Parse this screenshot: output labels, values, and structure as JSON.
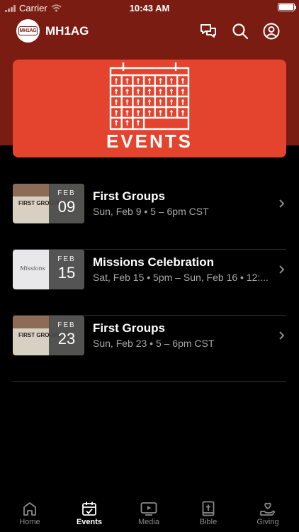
{
  "status_bar": {
    "carrier": "Carrier",
    "time": "10:43 AM"
  },
  "header": {
    "logo_text": "MH1AG",
    "title": "MH1AG"
  },
  "banner": {
    "text": "EVENTS",
    "color": "#e4442e"
  },
  "events": [
    {
      "thumb_text": "FIRST GROUPS",
      "month": "FEB",
      "day": "09",
      "title": "First Groups",
      "subtitle": "Sun, Feb 9 • 5 – 6pm CST"
    },
    {
      "thumb_text": "Missions",
      "month": "FEB",
      "day": "15",
      "title": "Missions Celebration",
      "subtitle": "Sat, Feb 15 • 5pm – Sun, Feb 16 • 12:..."
    },
    {
      "thumb_text": "FIRST GROUPS",
      "month": "FEB",
      "day": "23",
      "title": "First Groups",
      "subtitle": "Sun, Feb 23 • 5 – 6pm CST"
    }
  ],
  "tabs": [
    {
      "label": "Home",
      "icon": "home-icon",
      "active": false
    },
    {
      "label": "Events",
      "icon": "calendar-icon",
      "active": true
    },
    {
      "label": "Media",
      "icon": "play-icon",
      "active": false
    },
    {
      "label": "Bible",
      "icon": "bible-icon",
      "active": false
    },
    {
      "label": "Giving",
      "icon": "giving-icon",
      "active": false
    }
  ],
  "colors": {
    "header_bg": "#7a1c12",
    "accent": "#e4442e",
    "background": "#000000"
  }
}
